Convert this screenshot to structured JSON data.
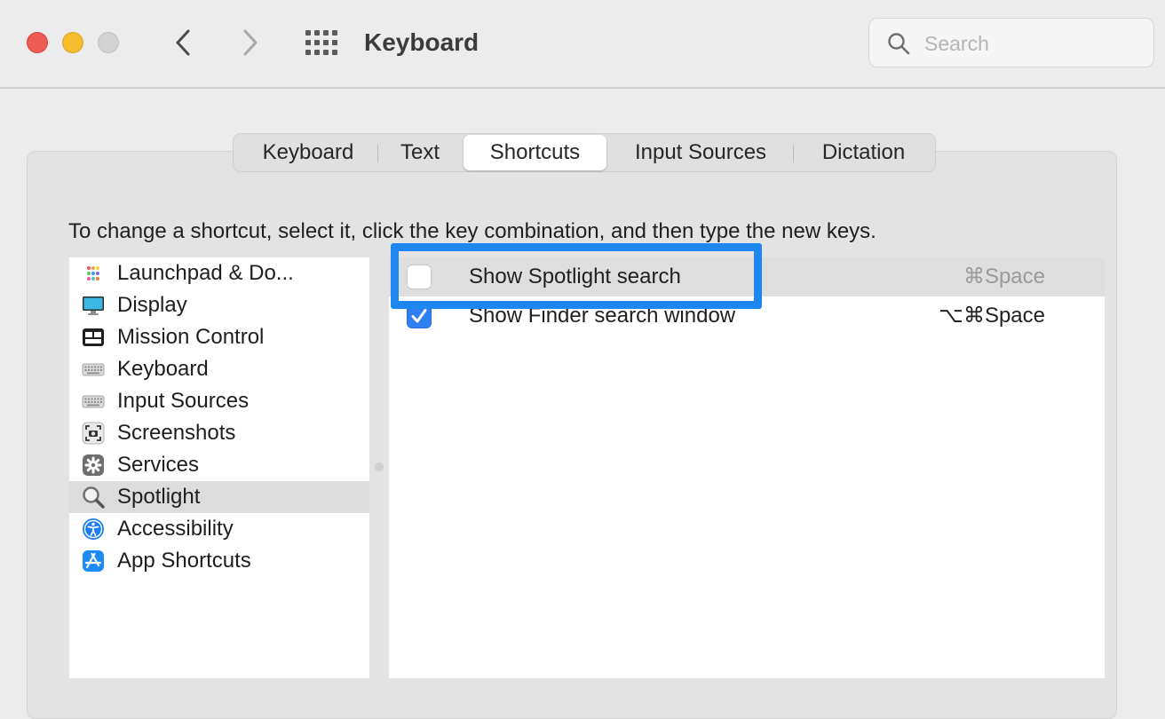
{
  "window": {
    "title": "Keyboard",
    "search_placeholder": "Search"
  },
  "tabs": [
    {
      "label": "Keyboard",
      "active": false
    },
    {
      "label": "Text",
      "active": false
    },
    {
      "label": "Shortcuts",
      "active": true
    },
    {
      "label": "Input Sources",
      "active": false
    },
    {
      "label": "Dictation",
      "active": false
    }
  ],
  "instructions": "To change a shortcut, select it, click the key combination, and then type the new keys.",
  "categories": [
    {
      "label": "Launchpad & Do...",
      "icon": "launchpad-icon",
      "selected": false
    },
    {
      "label": "Display",
      "icon": "display-icon",
      "selected": false
    },
    {
      "label": "Mission Control",
      "icon": "mission-control-icon",
      "selected": false
    },
    {
      "label": "Keyboard",
      "icon": "keyboard-icon",
      "selected": false
    },
    {
      "label": "Input Sources",
      "icon": "keyboard-icon",
      "selected": false
    },
    {
      "label": "Screenshots",
      "icon": "screenshot-icon",
      "selected": false
    },
    {
      "label": "Services",
      "icon": "gear-icon",
      "selected": false
    },
    {
      "label": "Spotlight",
      "icon": "magnifier-icon",
      "selected": true
    },
    {
      "label": "Accessibility",
      "icon": "accessibility-icon",
      "selected": false
    },
    {
      "label": "App Shortcuts",
      "icon": "app-store-icon",
      "selected": false
    }
  ],
  "shortcuts": [
    {
      "label": "Show Spotlight search",
      "keys": "⌘Space",
      "checked": false,
      "selected": true,
      "highlighted": true
    },
    {
      "label": "Show Finder search window",
      "keys": "⌥⌘Space",
      "checked": true,
      "selected": false,
      "highlighted": false
    }
  ],
  "colors": {
    "accent": "#2f7ff2",
    "highlight_box": "#1e86f0",
    "close": "#ee5a54",
    "minimize": "#f6bd2f",
    "zoom_disabled": "#d2d2d2"
  }
}
